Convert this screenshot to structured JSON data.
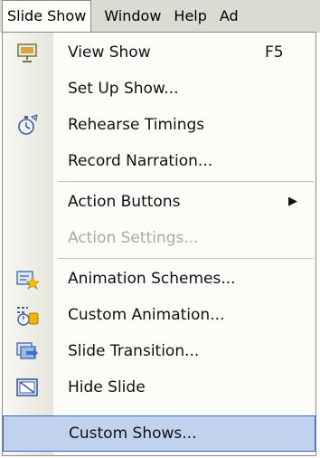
{
  "menubar": {
    "items": [
      {
        "label": "Slide Show"
      },
      {
        "label": "Window"
      },
      {
        "label": "Help"
      },
      {
        "label": "Ad"
      }
    ]
  },
  "menu": {
    "items": [
      {
        "label": "View Show",
        "shortcut": "F5",
        "icon": "projector-icon"
      },
      {
        "label": "Set Up Show..."
      },
      {
        "label": "Rehearse Timings",
        "icon": "stopwatch-icon"
      },
      {
        "label": "Record Narration..."
      },
      {
        "label": "Action Buttons",
        "submenu": "▶"
      },
      {
        "label": "Action Settings...",
        "state": "disabled"
      },
      {
        "label": "Animation Schemes...",
        "icon": "animation-schemes-icon"
      },
      {
        "label": "Custom Animation...",
        "icon": "custom-animation-icon"
      },
      {
        "label": "Slide Transition...",
        "icon": "slide-transition-icon"
      },
      {
        "label": "Hide Slide",
        "icon": "hide-slide-icon"
      },
      {
        "label": "Custom Shows...",
        "state": "highlighted"
      }
    ]
  },
  "colors": {
    "menubar_bg": "#dcdbd3",
    "menu_bg": "#fcfcf9",
    "highlight_bg": "#c1d2ee",
    "highlight_border": "#316ac5",
    "disabled_text": "#a9a9a4"
  }
}
